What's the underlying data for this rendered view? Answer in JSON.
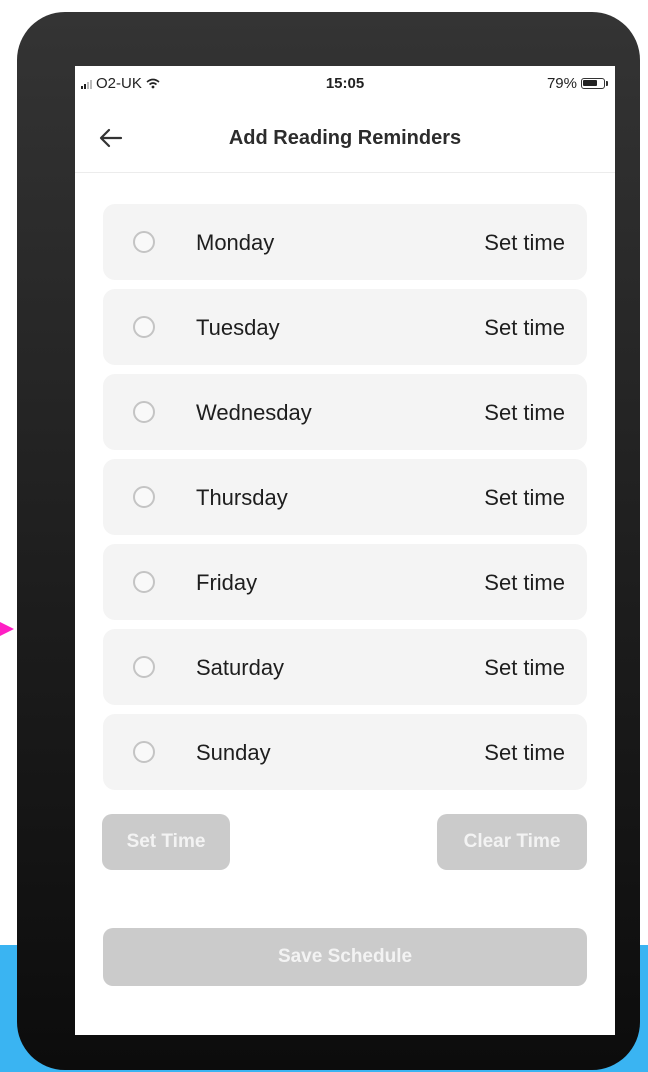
{
  "status_bar": {
    "carrier": "O2-UK",
    "time": "15:05",
    "battery": "79%",
    "battery_level": 0.79
  },
  "header": {
    "title": "Add Reading Reminders",
    "back_icon": "arrow-left-icon"
  },
  "days": [
    {
      "label": "Monday",
      "action": "Set time",
      "selected": false
    },
    {
      "label": "Tuesday",
      "action": "Set time",
      "selected": false
    },
    {
      "label": "Wednesday",
      "action": "Set time",
      "selected": false
    },
    {
      "label": "Thursday",
      "action": "Set time",
      "selected": false
    },
    {
      "label": "Friday",
      "action": "Set time",
      "selected": false
    },
    {
      "label": "Saturday",
      "action": "Set time",
      "selected": false
    },
    {
      "label": "Sunday",
      "action": "Set time",
      "selected": false
    }
  ],
  "buttons": {
    "set_time": "Set Time",
    "clear_time": "Clear Time",
    "save_schedule": "Save Schedule"
  },
  "colors": {
    "row_bg": "#f4f4f4",
    "disabled_button": "#cbcbcb",
    "page_accent_blue": "#3ab4f2",
    "annotation_pink": "#ff1fc4"
  }
}
